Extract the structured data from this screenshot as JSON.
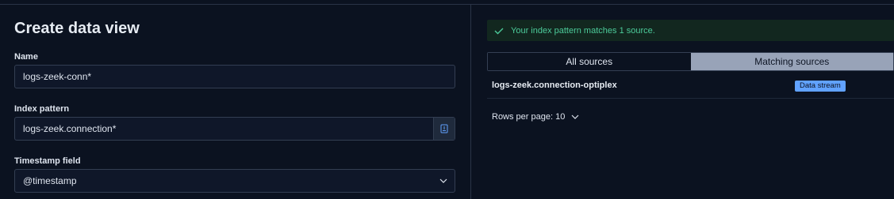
{
  "left": {
    "title": "Create data view",
    "name": {
      "label": "Name",
      "value": "logs-zeek-conn*"
    },
    "index_pattern": {
      "label": "Index pattern",
      "value": "logs-zeek.connection*"
    },
    "timestamp": {
      "label": "Timestamp field",
      "value": "@timestamp"
    }
  },
  "right": {
    "callout": "Your index pattern matches 1 source.",
    "tabs": [
      "All sources",
      "Matching sources"
    ],
    "rows": [
      {
        "name": "logs-zeek.connection-optiplex",
        "badge": "Data stream"
      }
    ],
    "rows_per_page": "Rows per page: 10"
  },
  "colors": {
    "background": "#0b1220",
    "success": "#4ccb9a",
    "badge": "#61a2ff",
    "selected_tab": "#98a3b8"
  },
  "icons": [
    "index-pattern-icon",
    "chevron-down-icon",
    "check-icon"
  ]
}
